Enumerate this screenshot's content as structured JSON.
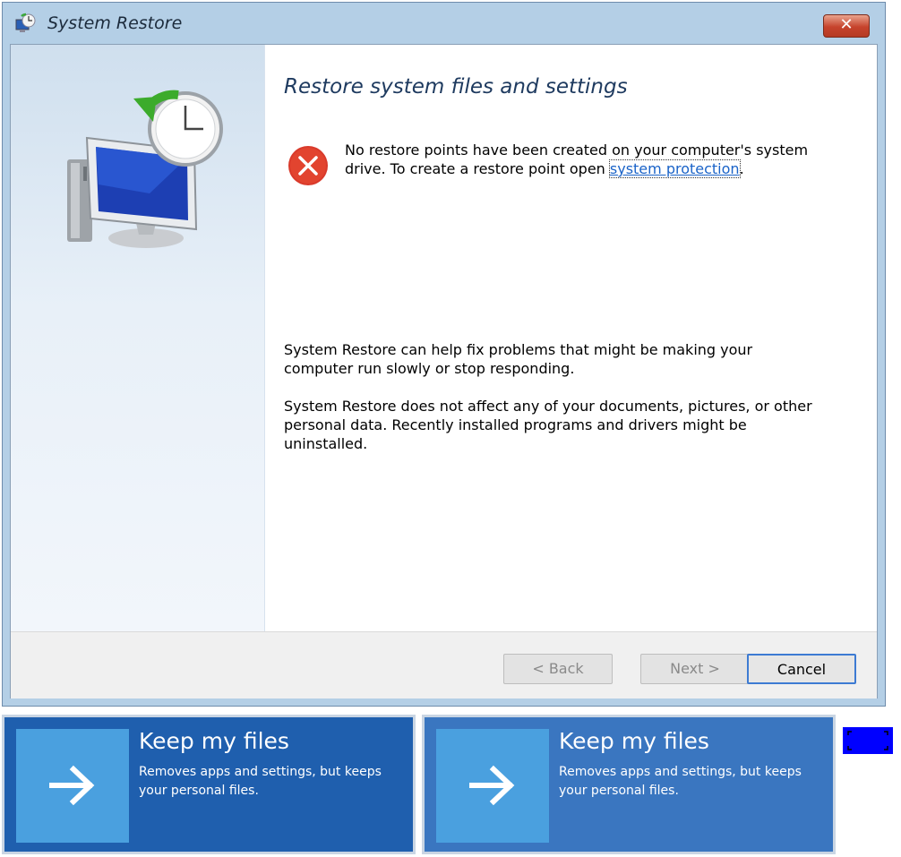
{
  "window": {
    "title": "System Restore",
    "close_label": "✕"
  },
  "main": {
    "heading": "Restore system files and settings",
    "error_message_before_link": "No restore points have been created on your computer's system drive. To create a restore point open ",
    "error_link": "system protection",
    "error_message_after_link": ".",
    "paragraph_1": "System Restore can help fix problems that might be making your computer run slowly or stop responding.",
    "paragraph_2": "System Restore does not affect any of your documents, pictures, or other personal data. Recently installed programs and drivers might be uninstalled."
  },
  "footer": {
    "back_label": "< Back",
    "next_label": "Next >",
    "cancel_label": "Cancel"
  },
  "tiles": [
    {
      "title": "Keep my files",
      "description": "Removes apps and settings, but keeps your personal files.",
      "icon": "arrow-right-icon"
    },
    {
      "title": "Keep my files",
      "description": "Removes apps and settings, but keeps your personal files.",
      "icon": "arrow-right-icon"
    }
  ],
  "colors": {
    "tile_dark": "#1f5fae",
    "tile_light": "#3a76c0",
    "tile_icon_bg": "#4aa0df",
    "link": "#1a63c8",
    "error_red": "#d93a2b",
    "marker": "#0000ff"
  }
}
